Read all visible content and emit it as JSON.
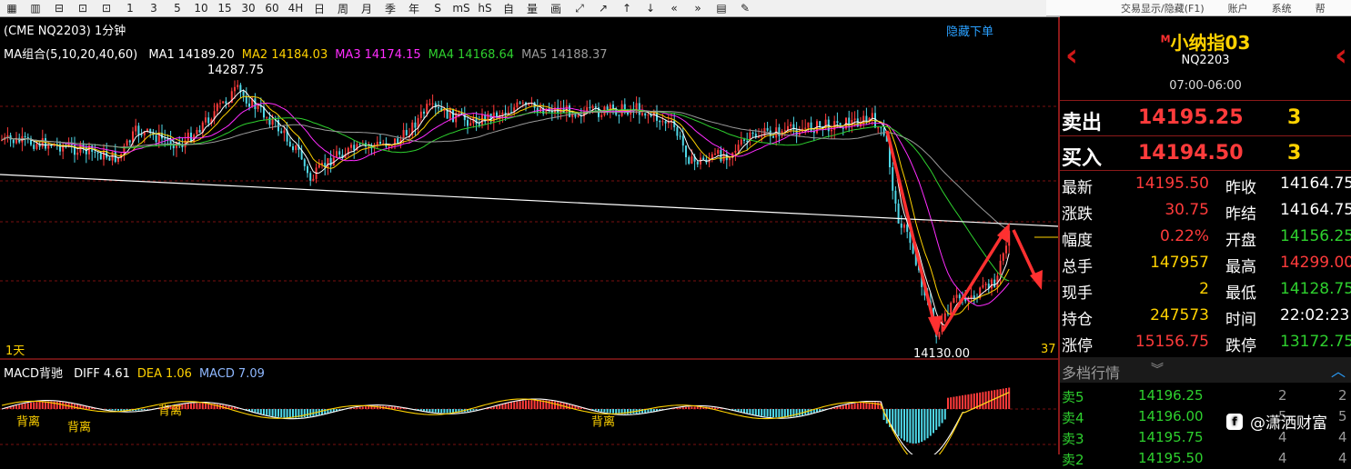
{
  "toolbar": {
    "icons": [
      "grid-icon",
      "split-icon",
      "k-line-icon",
      "bar-icon",
      "line-icon",
      "period-1m-icon",
      "period-3m-icon",
      "period-5m-icon",
      "period-10m-icon",
      "period-15m-icon",
      "period-30m-icon",
      "period-60m-icon",
      "period-4h-icon",
      "day-icon",
      "week-icon",
      "month-icon",
      "quarter-icon",
      "year-icon",
      "multi-second-icon",
      "multi-minute-icon",
      "multi-hour-icon",
      "indicator-icon",
      "volume-icon",
      "draw-icon",
      "zoom-out-icon",
      "cursor-icon",
      "up-icon",
      "down-icon",
      "fast-back-icon",
      "fast-forward-icon",
      "list-icon",
      "pen-icon"
    ],
    "glyphs": [
      "▦",
      "▥",
      "⊟",
      "⊡",
      "⊡",
      "1",
      "3",
      "5",
      "10",
      "15",
      "30",
      "60",
      "4H",
      "日",
      "周",
      "月",
      "季",
      "年",
      "S",
      "mS",
      "hS",
      "自",
      "量",
      "画",
      "⤢",
      "↗",
      "↑",
      "↓",
      "«",
      "»",
      "▤",
      "✎"
    ],
    "right_items": [
      "交易显示/隐藏(F1)",
      "账户",
      "系统",
      "帮"
    ]
  },
  "chart": {
    "symbol_label": "(CME NQ2203)",
    "period_label": "1分钟",
    "hide_orders_label": "隐藏下单",
    "ma_group_label": "MA组合(5,10,20,40,60)",
    "ma_legend": [
      {
        "name": "MA1",
        "value": "14189.20",
        "color": "#ffffff"
      },
      {
        "name": "MA2",
        "value": "14184.03",
        "color": "#ffd200"
      },
      {
        "name": "MA3",
        "value": "14174.15",
        "color": "#ff2cff"
      },
      {
        "name": "MA4",
        "value": "14168.64",
        "color": "#2ed02e"
      },
      {
        "name": "MA5",
        "value": "14188.37",
        "color": "#9a9a9a"
      }
    ],
    "high_label": "14287.75",
    "low_label": "14130.00",
    "bottom_left_label": "1天",
    "bottom_right_label": "37",
    "macd_title": "MACD背驰",
    "macd_legend": [
      {
        "name": "DIFF",
        "value": "4.61",
        "color": "#ffffff"
      },
      {
        "name": "DEA",
        "value": "1.06",
        "color": "#ffd200"
      },
      {
        "name": "MACD",
        "value": "7.09",
        "color": "#8fb8ff"
      }
    ],
    "divergence_labels": [
      "背离",
      "背离",
      "背离",
      "背离"
    ]
  },
  "panel": {
    "contract_name": "小纳指03",
    "contract_superscript": "M",
    "contract_code": "NQ2203",
    "session": "07:00-06:00",
    "sell": {
      "label": "卖出",
      "price": "14195.25",
      "qty": "3"
    },
    "buy": {
      "label": "买入",
      "price": "14194.50",
      "qty": "3"
    },
    "stats": [
      {
        "l1": "最新",
        "v1": "14195.50",
        "c1": "#ff3b3b",
        "l2": "昨收",
        "v2": "14164.75",
        "c2": "#ffffff"
      },
      {
        "l1": "涨跌",
        "v1": "30.75",
        "c1": "#ff3b3b",
        "l2": "昨结",
        "v2": "14164.75",
        "c2": "#ffffff"
      },
      {
        "l1": "幅度",
        "v1": "0.22%",
        "c1": "#ff3b3b",
        "l2": "开盘",
        "v2": "14156.25",
        "c2": "#2ed02e"
      },
      {
        "l1": "总手",
        "v1": "147957",
        "c1": "#ffd200",
        "l2": "最高",
        "v2": "14299.00",
        "c2": "#ff3b3b"
      },
      {
        "l1": "现手",
        "v1": "2",
        "c1": "#ffd200",
        "l2": "最低",
        "v2": "14128.75",
        "c2": "#2ed02e"
      },
      {
        "l1": "持仓",
        "v1": "247573",
        "c1": "#ffd200",
        "l2": "时间",
        "v2": "22:02:23",
        "c2": "#ffffff"
      },
      {
        "l1": "涨停",
        "v1": "15156.75",
        "c1": "#ff3b3b",
        "l2": "跌停",
        "v2": "13172.75",
        "c2": "#2ed02e"
      }
    ],
    "orderbook_title": "多档行情",
    "orderbook": [
      {
        "label": "卖5",
        "price": "14196.25",
        "qty": "2",
        "qty2": "2"
      },
      {
        "label": "卖4",
        "price": "14196.00",
        "qty": "5",
        "qty2": "5"
      },
      {
        "label": "卖3",
        "price": "14195.75",
        "qty": "4",
        "qty2": "4"
      },
      {
        "label": "卖2",
        "price": "14195.50",
        "qty": "4",
        "qty2": "4"
      }
    ]
  },
  "watermark": {
    "text": "@潇洒财富"
  },
  "colors": {
    "up": "#ff3b3b",
    "down": "#4fd8e8",
    "ma5": "#ffffff",
    "ma10": "#ffd200",
    "ma20": "#ff2cff",
    "ma40": "#2ed02e",
    "ma60": "#9a9a9a",
    "grid": "#7a1010",
    "panel_border": "#8b1a1a"
  }
}
